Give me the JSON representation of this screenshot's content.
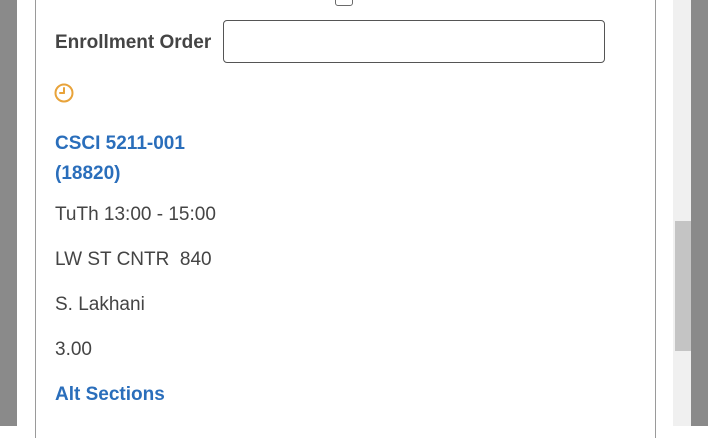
{
  "enrollment": {
    "label": "Enrollment Order",
    "value": ""
  },
  "course": {
    "title_line1": "CSCI 5211-001",
    "title_line2": "(18820)",
    "schedule": "TuTh 13:00 - 15:00",
    "location": "LW ST CNTR  840",
    "instructor": "S. Lakhani",
    "credits": "3.00",
    "alt_sections_label": "Alt Sections"
  },
  "colors": {
    "link": "#2a6ebb",
    "text": "#444444",
    "clock": "#e8a33a"
  },
  "icons": {
    "clock": "clock-icon"
  }
}
